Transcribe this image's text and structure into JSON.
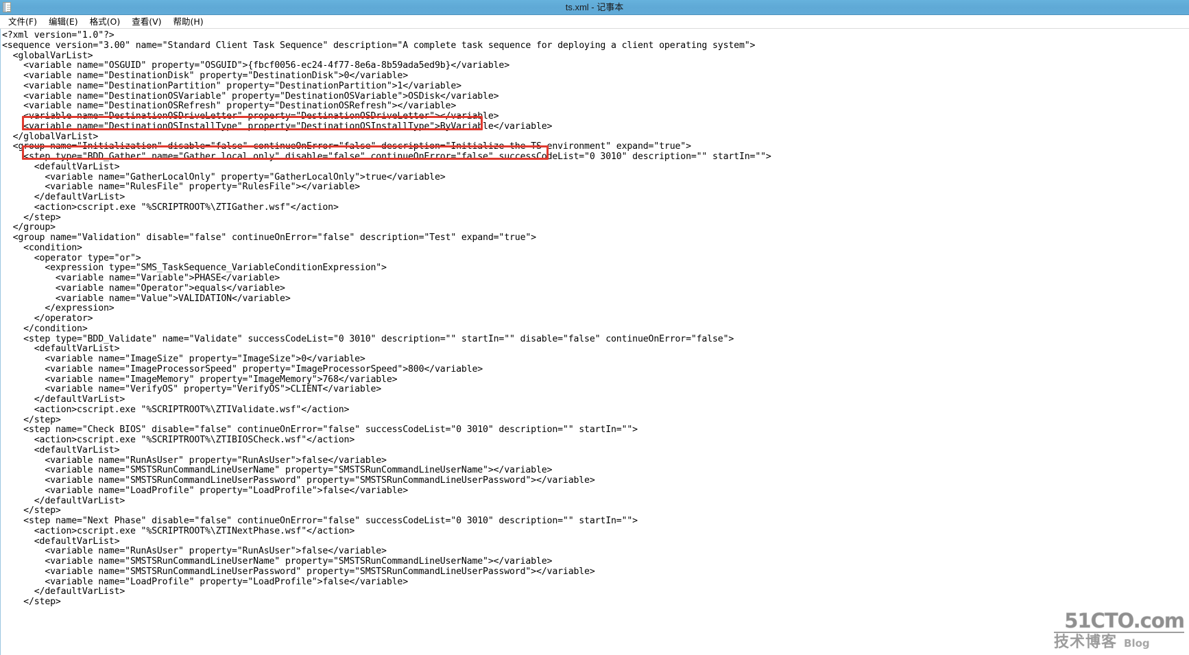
{
  "window": {
    "title": "ts.xml - 记事本",
    "icon": "notepad-icon",
    "accent_color": "#61abd8"
  },
  "menu": {
    "items": [
      {
        "label": "文件(F)",
        "name": "menu-file"
      },
      {
        "label": "编辑(E)",
        "name": "menu-edit"
      },
      {
        "label": "格式(O)",
        "name": "menu-format"
      },
      {
        "label": "查看(V)",
        "name": "menu-view"
      },
      {
        "label": "帮助(H)",
        "name": "menu-help"
      }
    ]
  },
  "annotations": {
    "color": "#e03a2f",
    "boxes": [
      {
        "id": "annot-1",
        "target_line": 5,
        "label": "DestinationOSVariable highlight"
      },
      {
        "id": "annot-2",
        "target_line": 8,
        "label": "DestinationOSInstallType highlight"
      }
    ]
  },
  "watermark": {
    "top": "51CTO.com",
    "bottom_cn": "技术博客",
    "bottom_en": "Blog"
  },
  "document": {
    "filename": "ts.xml",
    "lines": [
      "<?xml version=\"1.0\"?>",
      "<sequence version=\"3.00\" name=\"Standard Client Task Sequence\" description=\"A complete task sequence for deploying a client operating system\">",
      "  <globalVarList>",
      "    <variable name=\"OSGUID\" property=\"OSGUID\">{fbcf0056-ec24-4f77-8e6a-8b59ada5ed9b}</variable>",
      "    <variable name=\"DestinationDisk\" property=\"DestinationDisk\">0</variable>",
      "    <variable name=\"DestinationPartition\" property=\"DestinationPartition\">1</variable>",
      "    <variable name=\"DestinationOSVariable\" property=\"DestinationOSVariable\">OSDisk</variable>",
      "    <variable name=\"DestinationOSRefresh\" property=\"DestinationOSRefresh\"></variable>",
      "    <variable name=\"DestinationOSDriveLetter\" property=\"DestinationOSDriveLetter\"></variable>",
      "    <variable name=\"DestinationOSInstallType\" property=\"DestinationOSInstallType\">ByVariable</variable>",
      "  </globalVarList>",
      "  <group name=\"Initialization\" disable=\"false\" continueOnError=\"false\" description=\"Initialize the TS environment\" expand=\"true\">",
      "    <step type=\"BDD_Gather\" name=\"Gather local only\" disable=\"false\" continueOnError=\"false\" successCodeList=\"0 3010\" description=\"\" startIn=\"\">",
      "      <defaultVarList>",
      "        <variable name=\"GatherLocalOnly\" property=\"GatherLocalOnly\">true</variable>",
      "        <variable name=\"RulesFile\" property=\"RulesFile\"></variable>",
      "      </defaultVarList>",
      "      <action>cscript.exe \"%SCRIPTROOT%\\ZTIGather.wsf\"</action>",
      "    </step>",
      "  </group>",
      "  <group name=\"Validation\" disable=\"false\" continueOnError=\"false\" description=\"Test\" expand=\"true\">",
      "    <condition>",
      "      <operator type=\"or\">",
      "        <expression type=\"SMS_TaskSequence_VariableConditionExpression\">",
      "          <variable name=\"Variable\">PHASE</variable>",
      "          <variable name=\"Operator\">equals</variable>",
      "          <variable name=\"Value\">VALIDATION</variable>",
      "        </expression>",
      "      </operator>",
      "    </condition>",
      "    <step type=\"BDD_Validate\" name=\"Validate\" successCodeList=\"0 3010\" description=\"\" startIn=\"\" disable=\"false\" continueOnError=\"false\">",
      "      <defaultVarList>",
      "        <variable name=\"ImageSize\" property=\"ImageSize\">0</variable>",
      "        <variable name=\"ImageProcessorSpeed\" property=\"ImageProcessorSpeed\">800</variable>",
      "        <variable name=\"ImageMemory\" property=\"ImageMemory\">768</variable>",
      "        <variable name=\"VerifyOS\" property=\"VerifyOS\">CLIENT</variable>",
      "      </defaultVarList>",
      "      <action>cscript.exe \"%SCRIPTROOT%\\ZTIValidate.wsf\"</action>",
      "    </step>",
      "    <step name=\"Check BIOS\" disable=\"false\" continueOnError=\"false\" successCodeList=\"0 3010\" description=\"\" startIn=\"\">",
      "      <action>cscript.exe \"%SCRIPTROOT%\\ZTIBIOSCheck.wsf\"</action>",
      "      <defaultVarList>",
      "        <variable name=\"RunAsUser\" property=\"RunAsUser\">false</variable>",
      "        <variable name=\"SMSTSRunCommandLineUserName\" property=\"SMSTSRunCommandLineUserName\"></variable>",
      "        <variable name=\"SMSTSRunCommandLineUserPassword\" property=\"SMSTSRunCommandLineUserPassword\"></variable>",
      "        <variable name=\"LoadProfile\" property=\"LoadProfile\">false</variable>",
      "      </defaultVarList>",
      "    </step>",
      "    <step name=\"Next Phase\" disable=\"false\" continueOnError=\"false\" successCodeList=\"0 3010\" description=\"\" startIn=\"\">",
      "      <action>cscript.exe \"%SCRIPTROOT%\\ZTINextPhase.wsf\"</action>",
      "      <defaultVarList>",
      "        <variable name=\"RunAsUser\" property=\"RunAsUser\">false</variable>",
      "        <variable name=\"SMSTSRunCommandLineUserName\" property=\"SMSTSRunCommandLineUserName\"></variable>",
      "        <variable name=\"SMSTSRunCommandLineUserPassword\" property=\"SMSTSRunCommandLineUserPassword\"></variable>",
      "        <variable name=\"LoadProfile\" property=\"LoadProfile\">false</variable>",
      "      </defaultVarList>",
      "    </step>"
    ]
  }
}
